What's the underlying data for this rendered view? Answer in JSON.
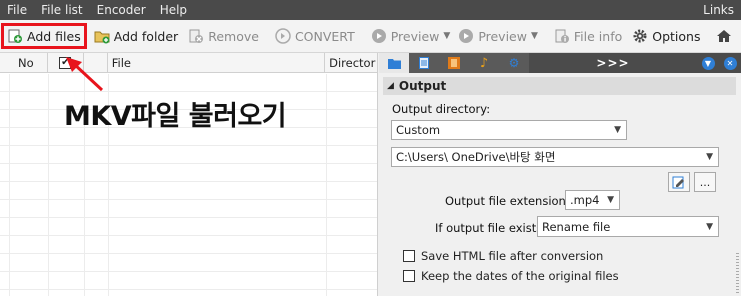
{
  "menu": {
    "items": [
      "File",
      "File list",
      "Encoder",
      "Help"
    ],
    "right": "Links"
  },
  "toolbar": {
    "add_files": "Add files",
    "add_folder": "Add folder",
    "remove": "Remove",
    "convert": "CONVERT",
    "preview1": "Preview",
    "preview2": "Preview",
    "file_info": "File info",
    "options": "Options"
  },
  "filelist": {
    "columns": [
      "No",
      "",
      "File",
      "Director"
    ]
  },
  "annotation": {
    "text": "MKV파일 불러오기",
    "color": "#e8141c"
  },
  "panel": {
    "tabs_more": ">>>",
    "section": "Output",
    "output_directory_label": "Output directory:",
    "output_directory_mode": "Custom",
    "output_path": "C:\\Users\\          OneDrive\\바탕 화면",
    "ext_label": "Output file extension:",
    "ext_value": ".mp4",
    "exists_label": "If output file exists:",
    "exists_value": "Rename file",
    "browse": "...",
    "cb_html": "Save HTML file after conversion",
    "cb_dates": "Keep the dates of the original files"
  },
  "colors": {
    "menubar": "#4a4a4a",
    "accent_blue": "#2f7fd6",
    "highlight_red": "#e8141c"
  }
}
